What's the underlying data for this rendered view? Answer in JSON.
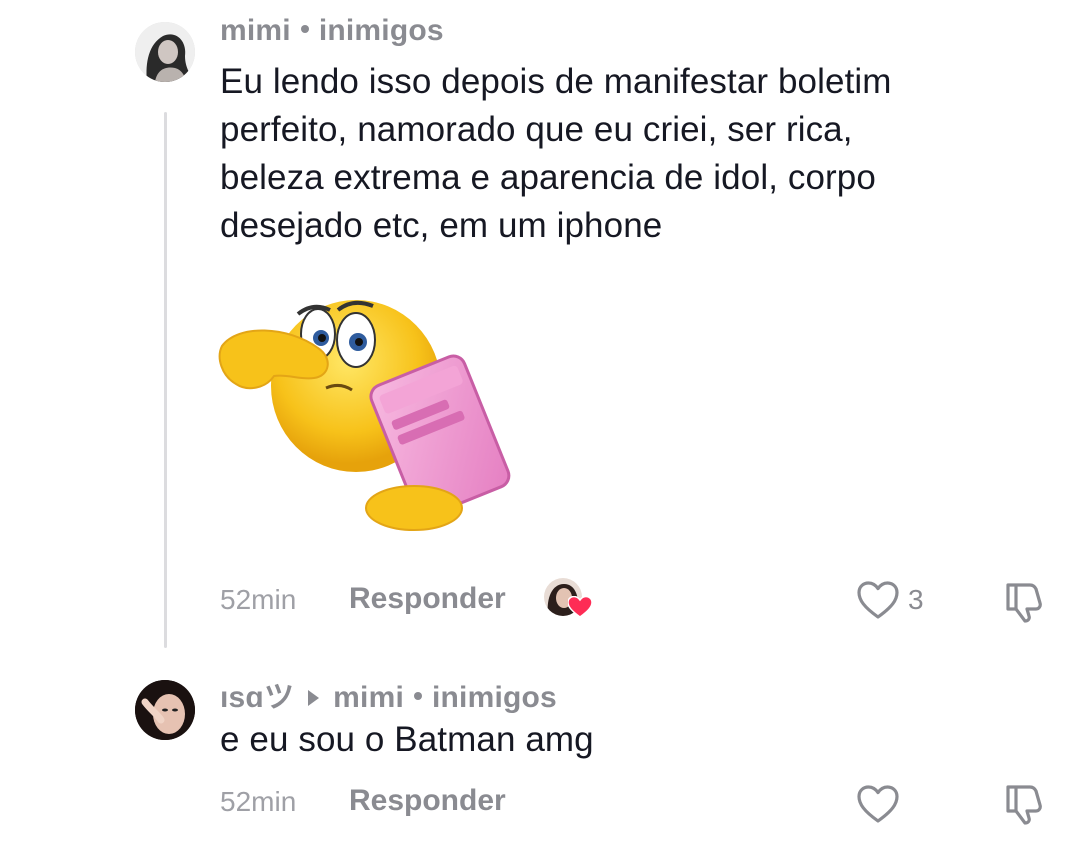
{
  "comments": [
    {
      "author": "mimi",
      "context": "inimigos",
      "text_lines": [
        "Eu lendo isso depois de manifestar boletim",
        "perfeito, namorado que eu criei, ser rica,",
        "beleza extrema e aparencia de idol, corpo",
        "desejado etc, em um iphone"
      ],
      "sticker": "emoji-sticker-covering-eyes-with-phone",
      "time": "52min",
      "reply_label": "Responder",
      "likes": "3"
    },
    {
      "author": "ısɑツ",
      "reply_to": "mimi",
      "context": "inimigos",
      "text": "e eu sou o Batman amg",
      "time": "52min",
      "reply_label": "Responder"
    }
  ],
  "colors": {
    "text": "#161823",
    "meta": "#8a8b91",
    "time": "#9fa0a6",
    "creator_liked_heart": "#fe2c55",
    "thread_line": "#dcdcdf"
  },
  "icons": [
    "heart-outline-icon",
    "dislike-icon",
    "creator-liked-heart-icon",
    "reply-arrow-icon"
  ]
}
